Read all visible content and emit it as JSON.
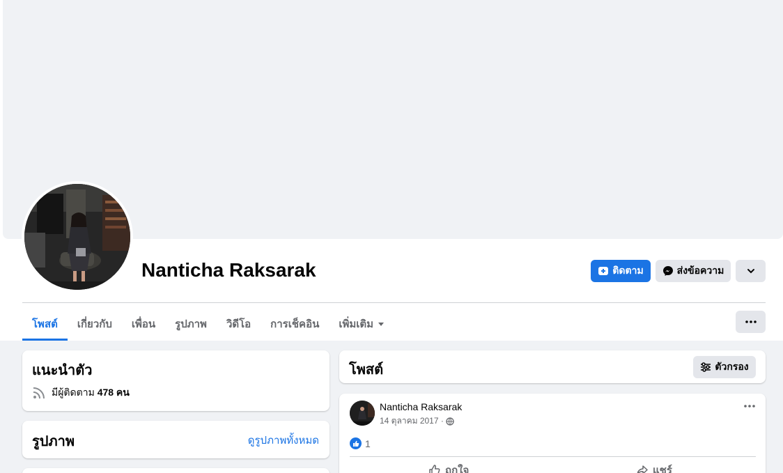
{
  "profile": {
    "name": "Nanticha Raksarak"
  },
  "actions": {
    "follow_label": "ติดตาม",
    "message_label": "ส่งข้อความ"
  },
  "tabs": [
    {
      "label": "โพสต์",
      "active": true
    },
    {
      "label": "เกี่ยวกับ"
    },
    {
      "label": "เพื่อน"
    },
    {
      "label": "รูปภาพ"
    },
    {
      "label": "วิดีโอ"
    },
    {
      "label": "การเช็คอิน"
    },
    {
      "label": "เพิ่มเติม"
    }
  ],
  "intro": {
    "title": "แนะนำตัว",
    "followers_prefix": "มีผู้ติดตาม",
    "followers_count": "478 คน"
  },
  "photos": {
    "title": "รูปภาพ",
    "see_all": "ดูรูปภาพทั้งหมด"
  },
  "posts": {
    "title": "โพสต์",
    "filter_label": "ตัวกรอง",
    "items": [
      {
        "author": "Nanticha Raksarak",
        "date": "14 ตุลาคม 2017 ·",
        "reaction_count": "1",
        "like_label": "ถูกใจ",
        "share_label": "แชร์"
      }
    ]
  },
  "colors": {
    "accent": "#1b74e4",
    "page_bg": "#f0f2f5",
    "button_gray": "#e4e6eb",
    "secondary_text": "#65676b"
  },
  "icons": {
    "follow": "follow-plus-icon",
    "message": "messenger-icon",
    "more": "chevron-down-icon",
    "tabs_more": "more-dots-icon",
    "followers": "rss-feed-icon",
    "filter": "sliders-icon",
    "privacy": "globe-icon",
    "like": "thumbs-up-icon",
    "share": "share-arrow-icon"
  }
}
